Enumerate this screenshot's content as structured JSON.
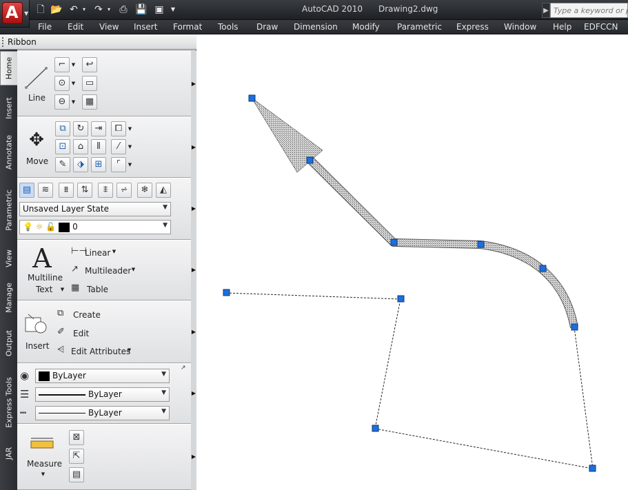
{
  "titlebar": {
    "app_title": "AutoCAD 2010",
    "file_name": "Drawing2.dwg",
    "search_placeholder": "Type a keyword or p",
    "app_icon_letter": "A",
    "qat_icons": [
      "new-icon",
      "open-icon",
      "undo-icon",
      "redo-icon",
      "plot-icon",
      "save-icon",
      "save-as-icon",
      "workspace-icon"
    ]
  },
  "menu": [
    "File",
    "Edit",
    "View",
    "Insert",
    "Format",
    "Tools",
    "Draw",
    "Dimension",
    "Modify",
    "Parametric",
    "Express",
    "Window",
    "Help",
    "EDFCCN"
  ],
  "ribbon": {
    "title": "Ribbon",
    "tabs": [
      "Home",
      "Insert",
      "Annotate",
      "Parametric",
      "View",
      "Manage",
      "Output",
      "Express Tools",
      "JAR"
    ],
    "draw": {
      "line_label": "Line"
    },
    "modify": {
      "move_label": "Move"
    },
    "layers": {
      "layer_state": "Unsaved Layer State",
      "current_layer": "0"
    },
    "annotation": {
      "multiline_label_1": "Multiline",
      "multiline_label_2": "Text",
      "linear_label": "Linear",
      "multileader_label": "Multileader",
      "table_label": "Table",
      "big_letter": "A"
    },
    "block": {
      "insert_label": "Insert",
      "create_label": "Create",
      "edit_label": "Edit",
      "edit_attributes_label": "Edit Attributes"
    },
    "properties": {
      "color": "ByLayer",
      "lineweight": "ByLayer",
      "linetype": "ByLayer"
    },
    "utilities": {
      "measure_label": "Measure"
    }
  },
  "colors": {
    "grip": "#1e6fd9",
    "titlebar": "#2b2e33",
    "ribbon_bg": "#e8e9eb"
  }
}
